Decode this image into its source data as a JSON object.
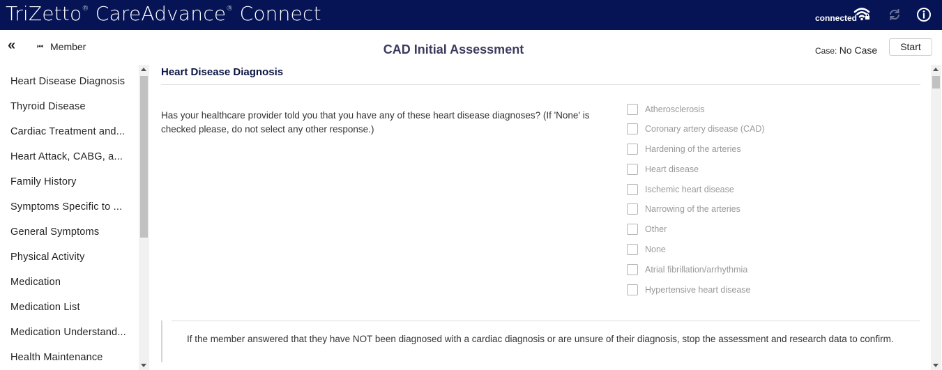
{
  "header": {
    "brand_tri": "TriZetto",
    "brand_app": " CareAdvance",
    "brand_connect": " Connect",
    "reg_mark": "®",
    "status": "connected",
    "wifi_icon": "wifi-lock-icon",
    "sync_icon": "sync-icon",
    "info_icon": "info-icon"
  },
  "toolbar": {
    "collapse_glyph": "«",
    "member_label": "Member",
    "title": "CAD Initial Assessment",
    "case_prefix": "Case:",
    "case_value": "No Case",
    "start_label": "Start"
  },
  "sidebar": {
    "items": [
      {
        "label": "Heart Disease Diagnosis"
      },
      {
        "label": "Thyroid Disease"
      },
      {
        "label": "Cardiac Treatment and..."
      },
      {
        "label": "Heart Attack, CABG, a..."
      },
      {
        "label": "Family History"
      },
      {
        "label": "Symptoms Specific to ..."
      },
      {
        "label": "General Symptoms"
      },
      {
        "label": "Physical Activity"
      },
      {
        "label": "Medication"
      },
      {
        "label": "Medication List"
      },
      {
        "label": "Medication Understand..."
      },
      {
        "label": "Health Maintenance"
      }
    ]
  },
  "main": {
    "section_title": "Heart Disease Diagnosis",
    "question": "Has your healthcare provider told you that you have any of these heart disease diagnoses? (If 'None' is checked please, do not select any other response.)",
    "options": [
      {
        "label": "Atherosclerosis",
        "checked": false
      },
      {
        "label": "Coronary artery disease (CAD)",
        "checked": false
      },
      {
        "label": "Hardening of the arteries",
        "checked": false
      },
      {
        "label": "Heart disease",
        "checked": false
      },
      {
        "label": "Ischemic heart disease",
        "checked": false
      },
      {
        "label": "Narrowing of the arteries",
        "checked": false
      },
      {
        "label": "Other",
        "checked": false
      },
      {
        "label": "None",
        "checked": false
      },
      {
        "label": "Atrial fibrillation/arrhythmia",
        "checked": false
      },
      {
        "label": "Hypertensive heart disease",
        "checked": false
      }
    ],
    "note": "If the member answered that they have NOT been diagnosed with a cardiac diagnosis or are unsure of their diagnosis, stop the assessment and research data to confirm."
  },
  "colors": {
    "header_bg": "#061455",
    "title_text": "#3a3a5e",
    "option_text": "#999999"
  }
}
